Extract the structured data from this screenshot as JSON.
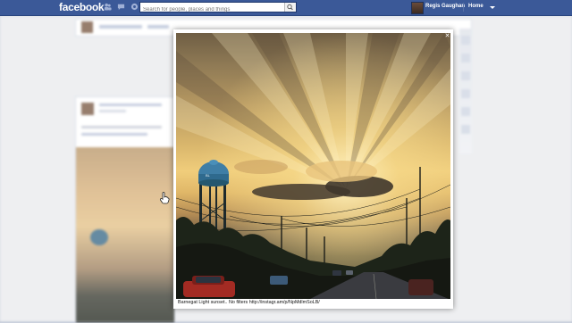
{
  "topbar": {
    "logo": "facebook",
    "search_placeholder": "Search for people, places and things",
    "user_name": "Regis Gaughan",
    "home_label": "Home",
    "icons": [
      "friend-requests-icon",
      "messages-icon",
      "notifications-icon",
      "search-icon",
      "account-caret-icon"
    ]
  },
  "viewer": {
    "caption": "Barnegat Light sunset.. No filters http://instagr.am/p/NpMdlmSoLB/"
  },
  "colors": {
    "topbar": "#3b5998",
    "topbar_border": "#29447e",
    "page_bg": "#e9ebee"
  }
}
